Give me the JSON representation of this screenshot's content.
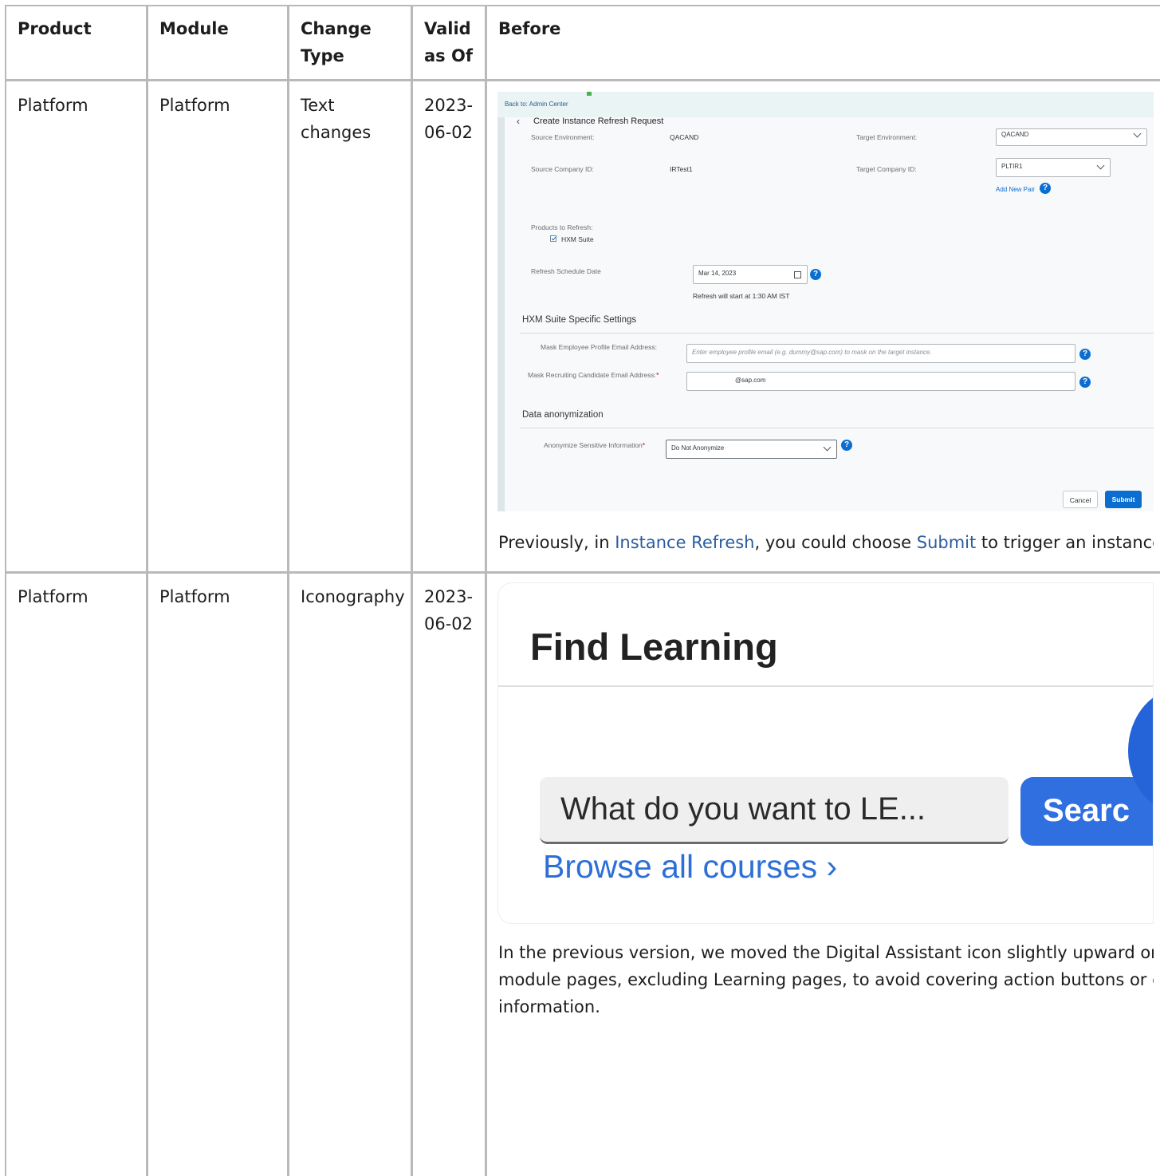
{
  "table": {
    "headers": [
      "Product",
      "Module",
      "Change Type",
      "Valid as Of",
      "Before"
    ],
    "header_lines": {
      "change_type": [
        "Change",
        "Type"
      ],
      "valid_as_of": [
        "Valid",
        "as Of"
      ]
    },
    "rows": [
      {
        "product": "Platform",
        "module": "Platform",
        "change_type": "Text changes",
        "change_type_lines": [
          "Text",
          "changes"
        ],
        "valid_as_of_lines": [
          "2023-",
          "06-02"
        ],
        "before_text": {
          "prefix": "Previously, in ",
          "kw1": "Instance Refresh",
          "middle": ", you could choose ",
          "kw2": "Submit",
          "suffix": " to trigger an instance r"
        }
      },
      {
        "product": "Platform",
        "module": "Platform",
        "change_type": "Iconography",
        "valid_as_of_lines": [
          "2023-",
          "06-02"
        ],
        "before_text_lines": [
          "In the previous version, we moved the Digital Assistant icon slightly upward on al",
          "module pages, excluding Learning pages, to avoid covering action buttons or cert",
          "information."
        ]
      }
    ]
  },
  "screenshot1": {
    "back_link": "Back to: Admin Center",
    "page_title": "Create Instance Refresh Request",
    "source_env_label": "Source Environment:",
    "source_env_value": "QACAND",
    "target_env_label": "Target Environment:",
    "target_env_value": "QACAND",
    "source_company_label": "Source Company ID:",
    "source_company_value": "IRTest1",
    "target_company_label": "Target Company ID:",
    "target_company_value": "PLTIR1",
    "add_pair_link": "Add New Pair",
    "products_label": "Products to Refresh:",
    "product_item": "HXM Suite",
    "schedule_label": "Refresh Schedule Date",
    "schedule_value": "Mar 14, 2023",
    "schedule_note": "Refresh will start at 1:30 AM IST",
    "section_hxm": "HXM Suite Specific Settings",
    "mask_employee_label": "Mask Employee Profile Email Address:",
    "mask_employee_placeholder": "Enter employee profile email (e.g. dummy@sap.com) to mask on the target instance.",
    "mask_candidate_label": "Mask Recruiting Candidate Email Address:",
    "mask_candidate_value": "@sap.com",
    "section_anon": "Data anonymization",
    "anon_label": "Anonymize Sensitive Information",
    "anon_value": "Do Not Anonymize",
    "cancel_label": "Cancel",
    "submit_label": "Submit",
    "accent_color": "#0a6ed1"
  },
  "screenshot2": {
    "title": "Find Learning",
    "search_placeholder": "What do you want to LE...",
    "search_button": "Searc",
    "browse_link": "Browse all courses ›",
    "accent_color": "#2f6fe0"
  }
}
